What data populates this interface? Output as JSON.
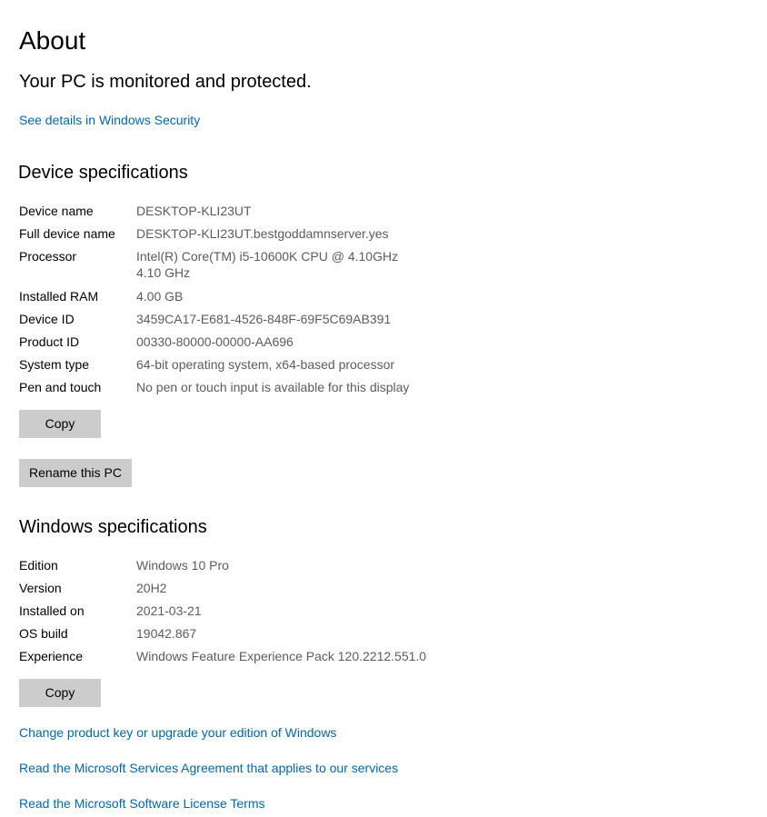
{
  "page": {
    "title": "About",
    "status": "Your PC is monitored and protected.",
    "security_link": "See details in Windows Security"
  },
  "device_specs": {
    "heading": "Device specifications",
    "rows": [
      {
        "label": "Device name",
        "value": "DESKTOP-KLI23UT"
      },
      {
        "label": "Full device name",
        "value": "DESKTOP-KLI23UT.bestgoddamnserver.yes"
      },
      {
        "label": "Processor",
        "value": "Intel(R) Core(TM) i5-10600K CPU @ 4.10GHz   4.10 GHz"
      },
      {
        "label": "Installed RAM",
        "value": "4.00 GB"
      },
      {
        "label": "Device ID",
        "value": "3459CA17-E681-4526-848F-69F5C69AB391"
      },
      {
        "label": "Product ID",
        "value": "00330-80000-00000-AA696"
      },
      {
        "label": "System type",
        "value": "64-bit operating system, x64-based processor"
      },
      {
        "label": "Pen and touch",
        "value": "No pen or touch input is available for this display"
      }
    ],
    "copy_label": "Copy",
    "rename_label": "Rename this PC"
  },
  "windows_specs": {
    "heading": "Windows specifications",
    "rows": [
      {
        "label": "Edition",
        "value": "Windows 10 Pro"
      },
      {
        "label": "Version",
        "value": "20H2"
      },
      {
        "label": "Installed on",
        "value": "2021-03-21"
      },
      {
        "label": "OS build",
        "value": "19042.867"
      },
      {
        "label": "Experience",
        "value": "Windows Feature Experience Pack 120.2212.551.0"
      }
    ],
    "copy_label": "Copy"
  },
  "links": {
    "product_key": "Change product key or upgrade your edition of Windows",
    "services_agreement": "Read the Microsoft Services Agreement that applies to our services",
    "license_terms": "Read the Microsoft Software License Terms"
  },
  "colors": {
    "link": "#0067b8",
    "button_bg": "#cccccc",
    "value_text": "#5c5c5c"
  }
}
